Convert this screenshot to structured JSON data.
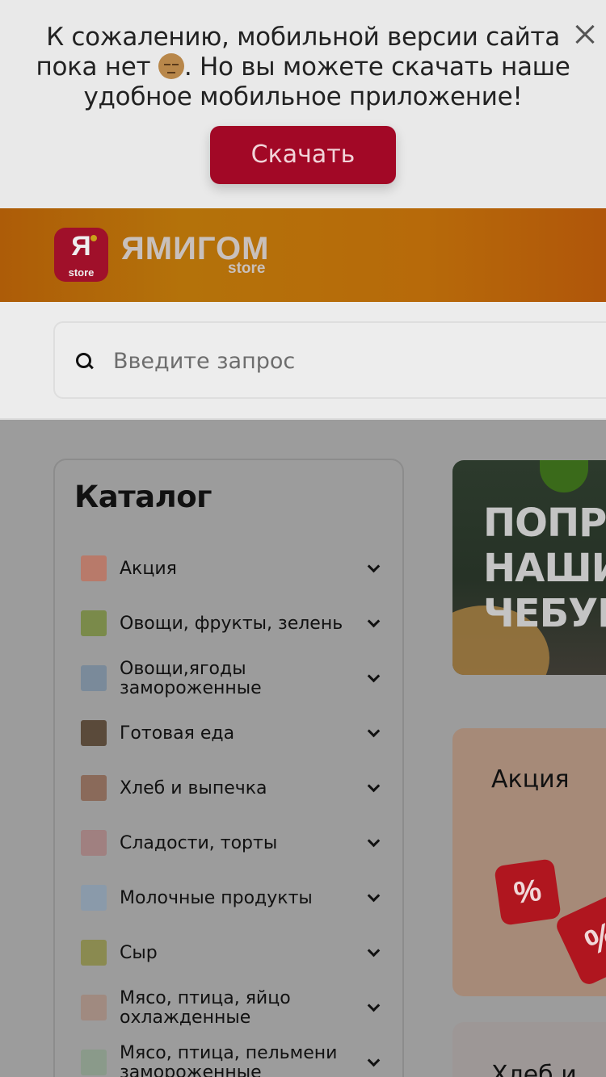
{
  "banner": {
    "text_before_emoji": "К сожалению, мобильной версии сайта пока нет ",
    "text_after_emoji": ". Но вы можете скачать наше удобное мобильное приложение!",
    "download_label": "Скачать"
  },
  "header": {
    "logo_letter": "Я",
    "logo_store": "store",
    "brand_name": "ЯМИГОМ",
    "brand_sub": "store"
  },
  "search": {
    "placeholder": "Введите запрос"
  },
  "catalog": {
    "title": "Каталог",
    "items": [
      {
        "label": "Акция",
        "thumb_color": "#b87a6a"
      },
      {
        "label": "Овощи, фрукты, зелень",
        "thumb_color": "#7a8a4a"
      },
      {
        "label": "Овощи,ягоды замороженные",
        "thumb_color": "#7a8a9a"
      },
      {
        "label": "Готовая еда",
        "thumb_color": "#5a4a3a"
      },
      {
        "label": "Хлеб и выпечка",
        "thumb_color": "#8a6a5a"
      },
      {
        "label": "Сладости, торты",
        "thumb_color": "#a08080"
      },
      {
        "label": "Молочные продукты",
        "thumb_color": "#8a9aaa"
      },
      {
        "label": "Сыр",
        "thumb_color": "#8a8a50"
      },
      {
        "label": "Мясо, птица, яйцо охлажденные",
        "thumb_color": "#a08a80"
      },
      {
        "label": "Мясо, птица, пельмени замороженные",
        "thumb_color": "#8a9a8a"
      }
    ]
  },
  "promo": {
    "text": "ПОПРОБ\nНАШИ\nЧЕБУРЕ"
  },
  "categories_cards": {
    "sale_title": "Акция",
    "sale_die_symbol": "%",
    "bread_title": "Хлеб и"
  }
}
